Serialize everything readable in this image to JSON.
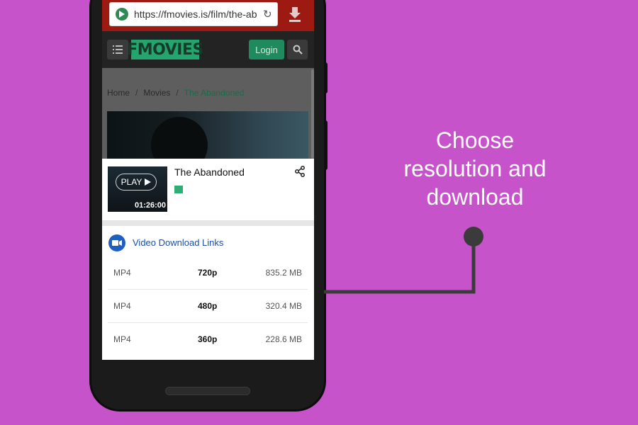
{
  "browser": {
    "url": "https://fmovies.is/film/the-ab",
    "reload_icon": "reload-icon",
    "download_icon": "download-icon"
  },
  "site": {
    "logo": "FMOVIES",
    "login_label": "Login",
    "menu_icon": "list-menu-icon",
    "search_icon": "search-icon"
  },
  "breadcrumb": {
    "items": [
      "Home",
      "Movies",
      "The Abandoned"
    ],
    "separator": "/"
  },
  "movie": {
    "title": "The Abandoned",
    "play_label": "PLAY",
    "duration": "01:26:00",
    "share_icon": "share-icon"
  },
  "downloads": {
    "heading": "Video Download Links",
    "rows": [
      {
        "format": "MP4",
        "resolution": "720p",
        "size": "835.2 MB"
      },
      {
        "format": "MP4",
        "resolution": "480p",
        "size": "320.4 MB"
      },
      {
        "format": "MP4",
        "resolution": "360p",
        "size": "228.6 MB"
      }
    ]
  },
  "callout": {
    "lines": [
      "Choose",
      "resolution and",
      "download"
    ]
  },
  "colors": {
    "background": "#c653c9",
    "accent_green": "#25a56e",
    "browser_bar": "#9d1a12",
    "link_blue": "#1c4fa3"
  }
}
